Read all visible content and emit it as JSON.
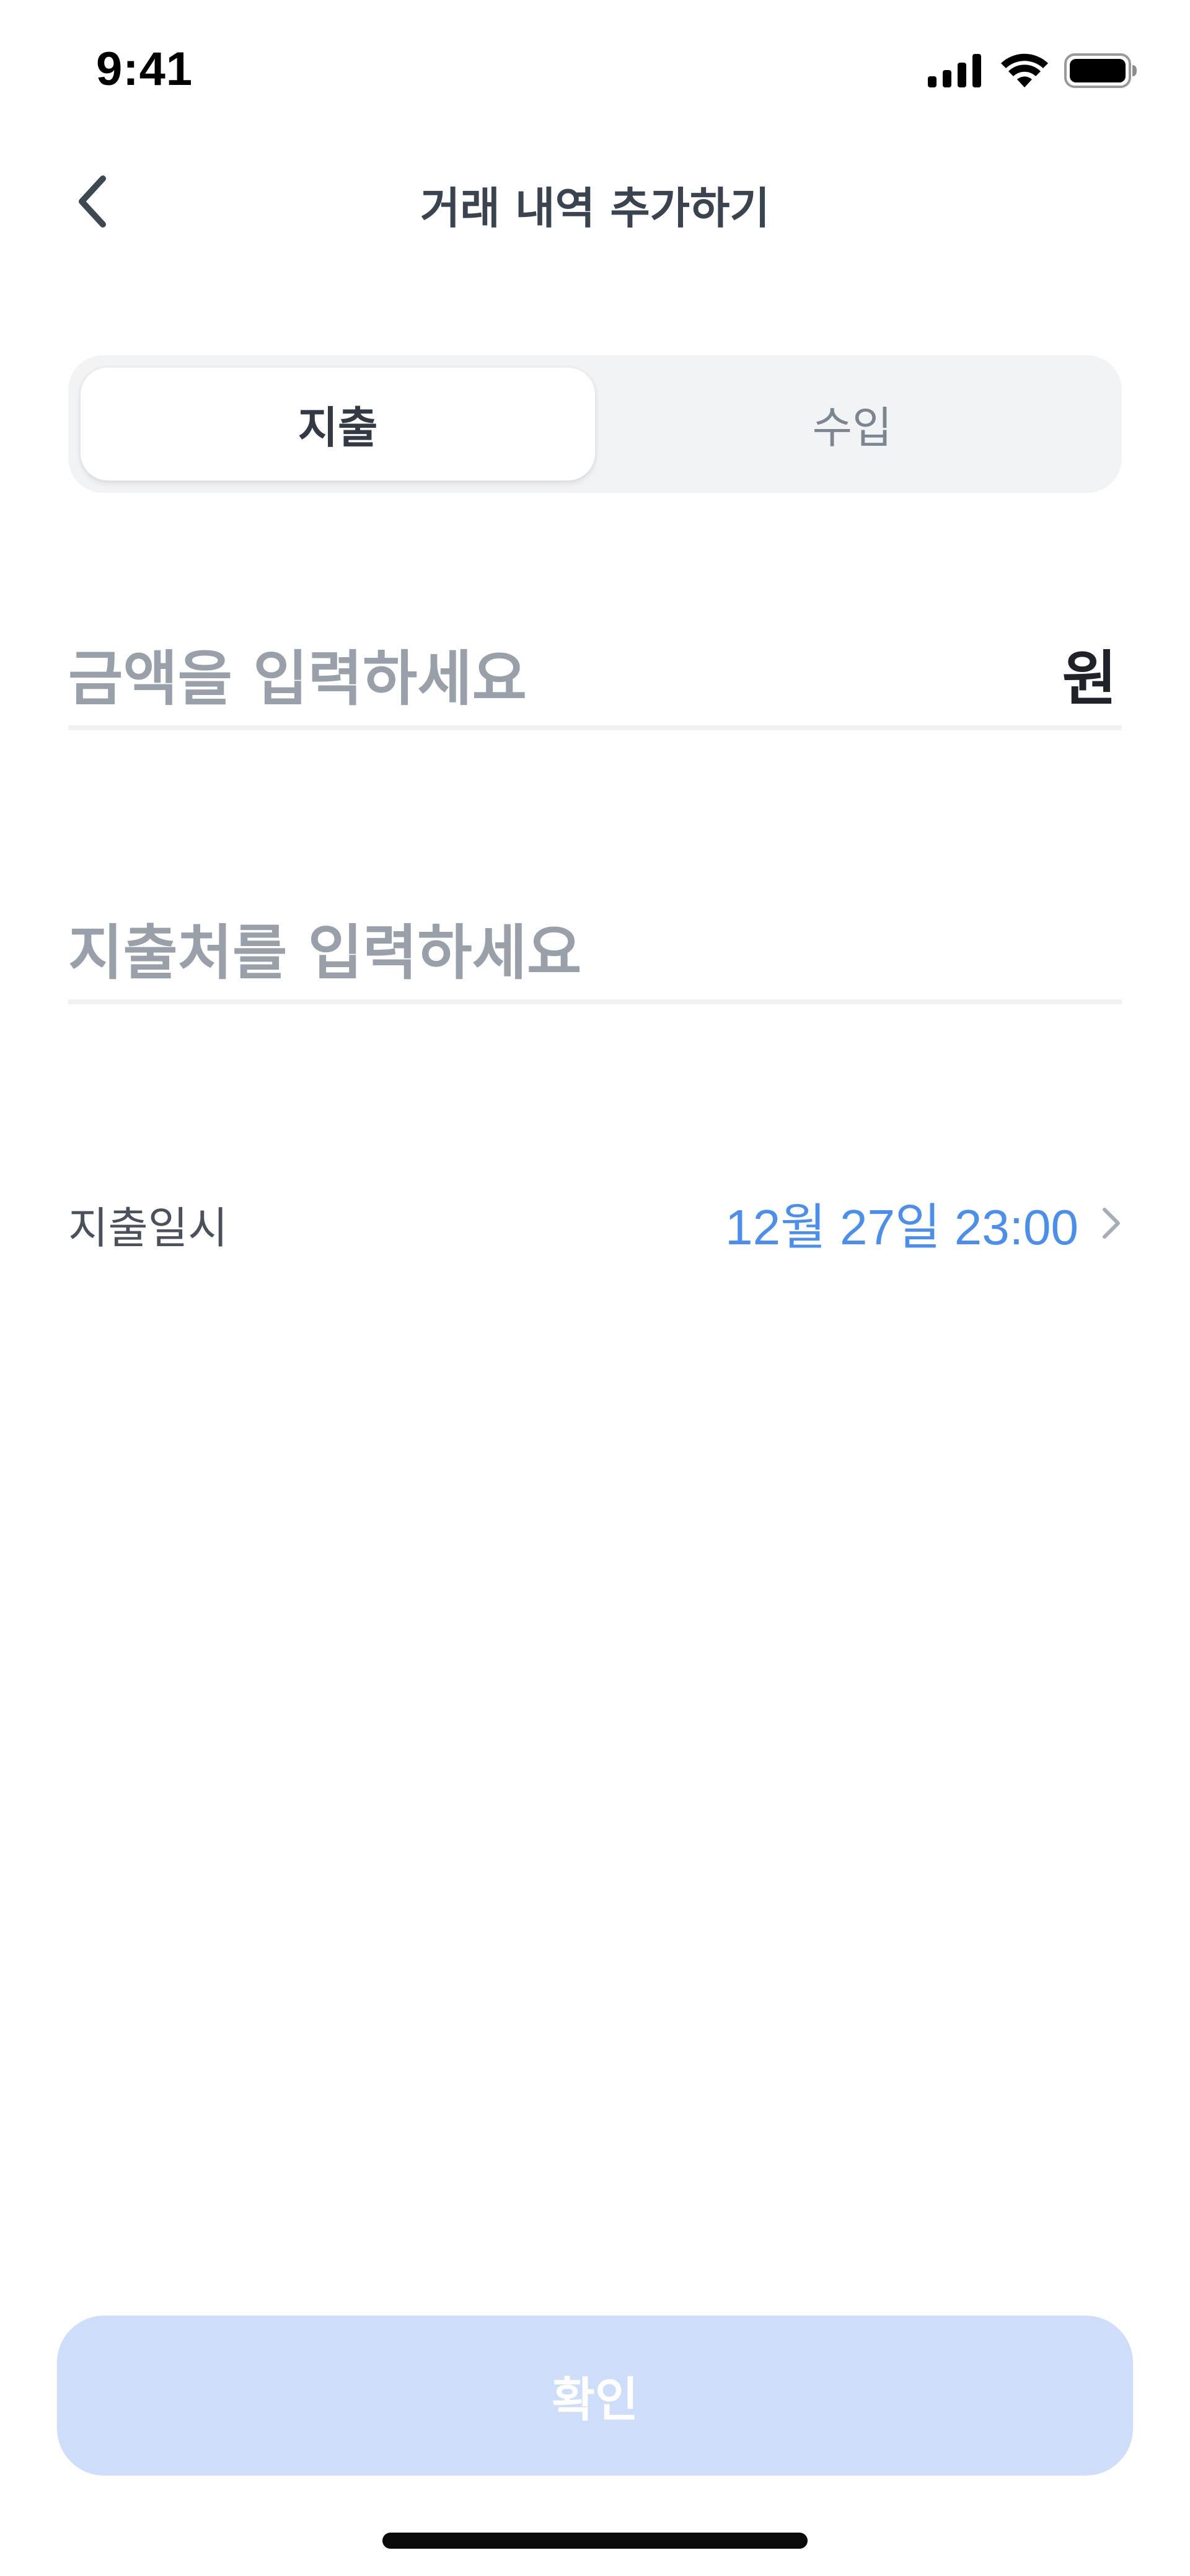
{
  "status_bar": {
    "time": "9:41",
    "icons": [
      "cellular-signal-icon",
      "wifi-icon",
      "battery-icon"
    ]
  },
  "nav": {
    "back_icon": "chevron-left-icon",
    "title": "거래 내역 추가하기"
  },
  "segmented": {
    "options": [
      {
        "label": "지출",
        "selected": true
      },
      {
        "label": "수입",
        "selected": false
      }
    ]
  },
  "form": {
    "amount": {
      "value": "",
      "placeholder": "금액을 입력하세요",
      "suffix": "원"
    },
    "merchant": {
      "value": "",
      "placeholder": "지출처를 입력하세요"
    },
    "date": {
      "label": "지출일시",
      "value": "12월 27일 23:00",
      "icon": "chevron-right-icon"
    }
  },
  "confirm": {
    "label": "확인",
    "enabled": false
  },
  "colors": {
    "accent": "#4a8ff0",
    "confirm_disabled_bg": "#cedefa",
    "segment_bg": "#f2f3f5",
    "placeholder": "#9aa0a9",
    "divider": "#f0f1f3"
  }
}
